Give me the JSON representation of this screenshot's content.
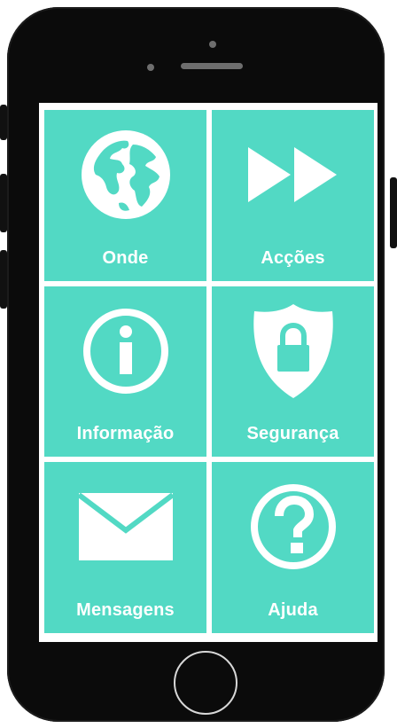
{
  "theme": {
    "tile_color": "#52d9c4",
    "label_color": "#ffffff",
    "phone_color": "#0b0b0b"
  },
  "menu": {
    "tiles": [
      {
        "label": "Onde",
        "icon": "globe-icon"
      },
      {
        "label": "Acções",
        "icon": "fast-forward-icon"
      },
      {
        "label": "Informação",
        "icon": "info-icon"
      },
      {
        "label": "Segurança",
        "icon": "shield-lock-icon"
      },
      {
        "label": "Mensagens",
        "icon": "envelope-icon"
      },
      {
        "label": "Ajuda",
        "icon": "help-icon"
      }
    ]
  }
}
